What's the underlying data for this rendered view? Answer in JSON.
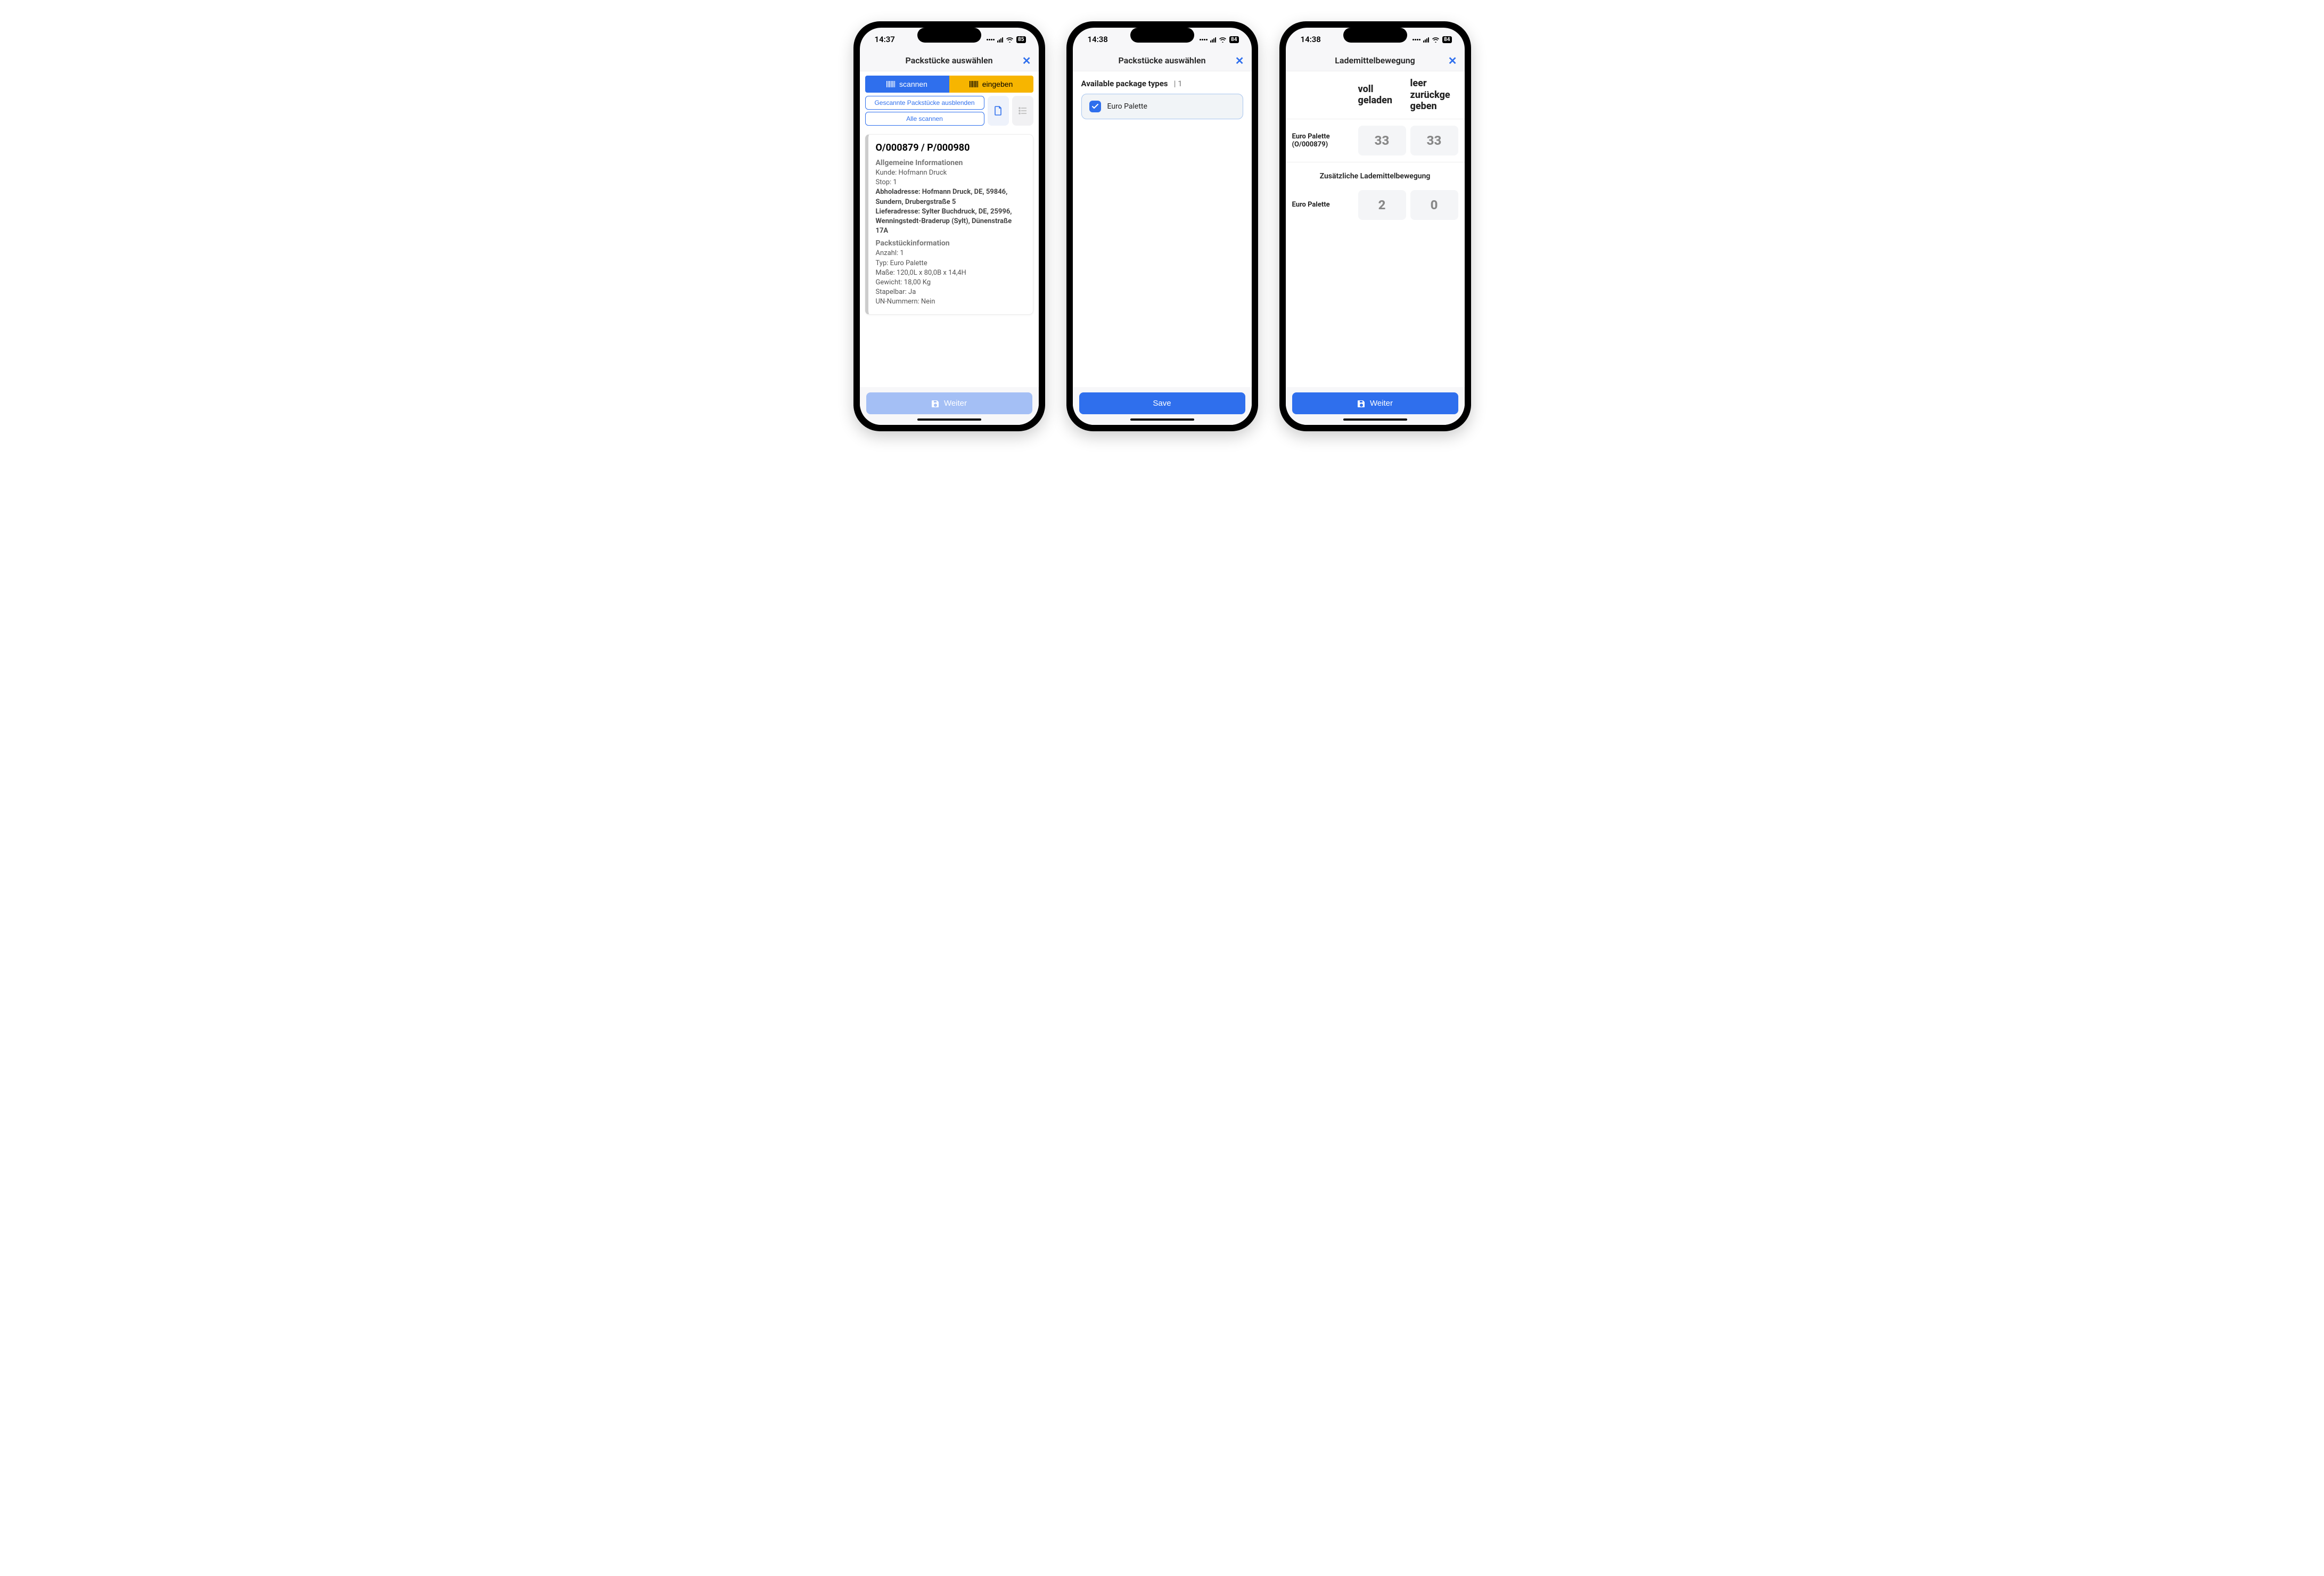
{
  "screens": [
    {
      "status": {
        "time": "14:37",
        "battery": "85"
      },
      "header": {
        "title": "Packstücke auswählen"
      },
      "segments": {
        "scan": "scannen",
        "enter": "eingeben"
      },
      "filters": {
        "hideScanned": "Gescannte Packstücke ausblenden",
        "scanAll": "Alle scannen"
      },
      "card": {
        "title": "O/000879 / P/000980",
        "generalHeading": "Allgemeine Informationen",
        "customer": "Kunde: Hofmann Druck",
        "stop": "Stop: 1",
        "pickup": "Abholadresse: Hofmann Druck, DE, 59846, Sundern, Drubergstraße 5",
        "delivery": "Lieferadresse: Sylter Buchdruck, DE, 25996, Wenningstedt-Braderup (Sylt), Dünenstraße 17A",
        "pkgHeading": "Packstückinformation",
        "count": "Anzahl: 1",
        "type": "Typ: Euro Palette",
        "dims": "Maße: 120,0L x 80,0B x 14,4H",
        "weight": "Gewicht: 18,00 Kg",
        "stackable": "Stapelbar: Ja",
        "un": "UN-Nummern: Nein"
      },
      "footer": {
        "label": "Weiter"
      }
    },
    {
      "status": {
        "time": "14:38",
        "battery": "84"
      },
      "header": {
        "title": "Packstücke auswählen"
      },
      "pkgTypes": {
        "label": "Available package types",
        "count": "1",
        "items": [
          "Euro Palette"
        ]
      },
      "footer": {
        "label": "Save"
      }
    },
    {
      "status": {
        "time": "14:38",
        "battery": "84"
      },
      "header": {
        "title": "Lademittelbewegung"
      },
      "columns": {
        "loaded": "voll geladen",
        "returned": "leer zurückge geben"
      },
      "rows": [
        {
          "label": "Euro Palette (O/000879)",
          "loaded": "33",
          "returned": "33"
        }
      ],
      "additionalHeading": "Zusätzliche Lademittelbewegung",
      "additionalRows": [
        {
          "label": "Euro Palette",
          "loaded": "2",
          "returned": "0"
        }
      ],
      "footer": {
        "label": "Weiter"
      }
    }
  ]
}
